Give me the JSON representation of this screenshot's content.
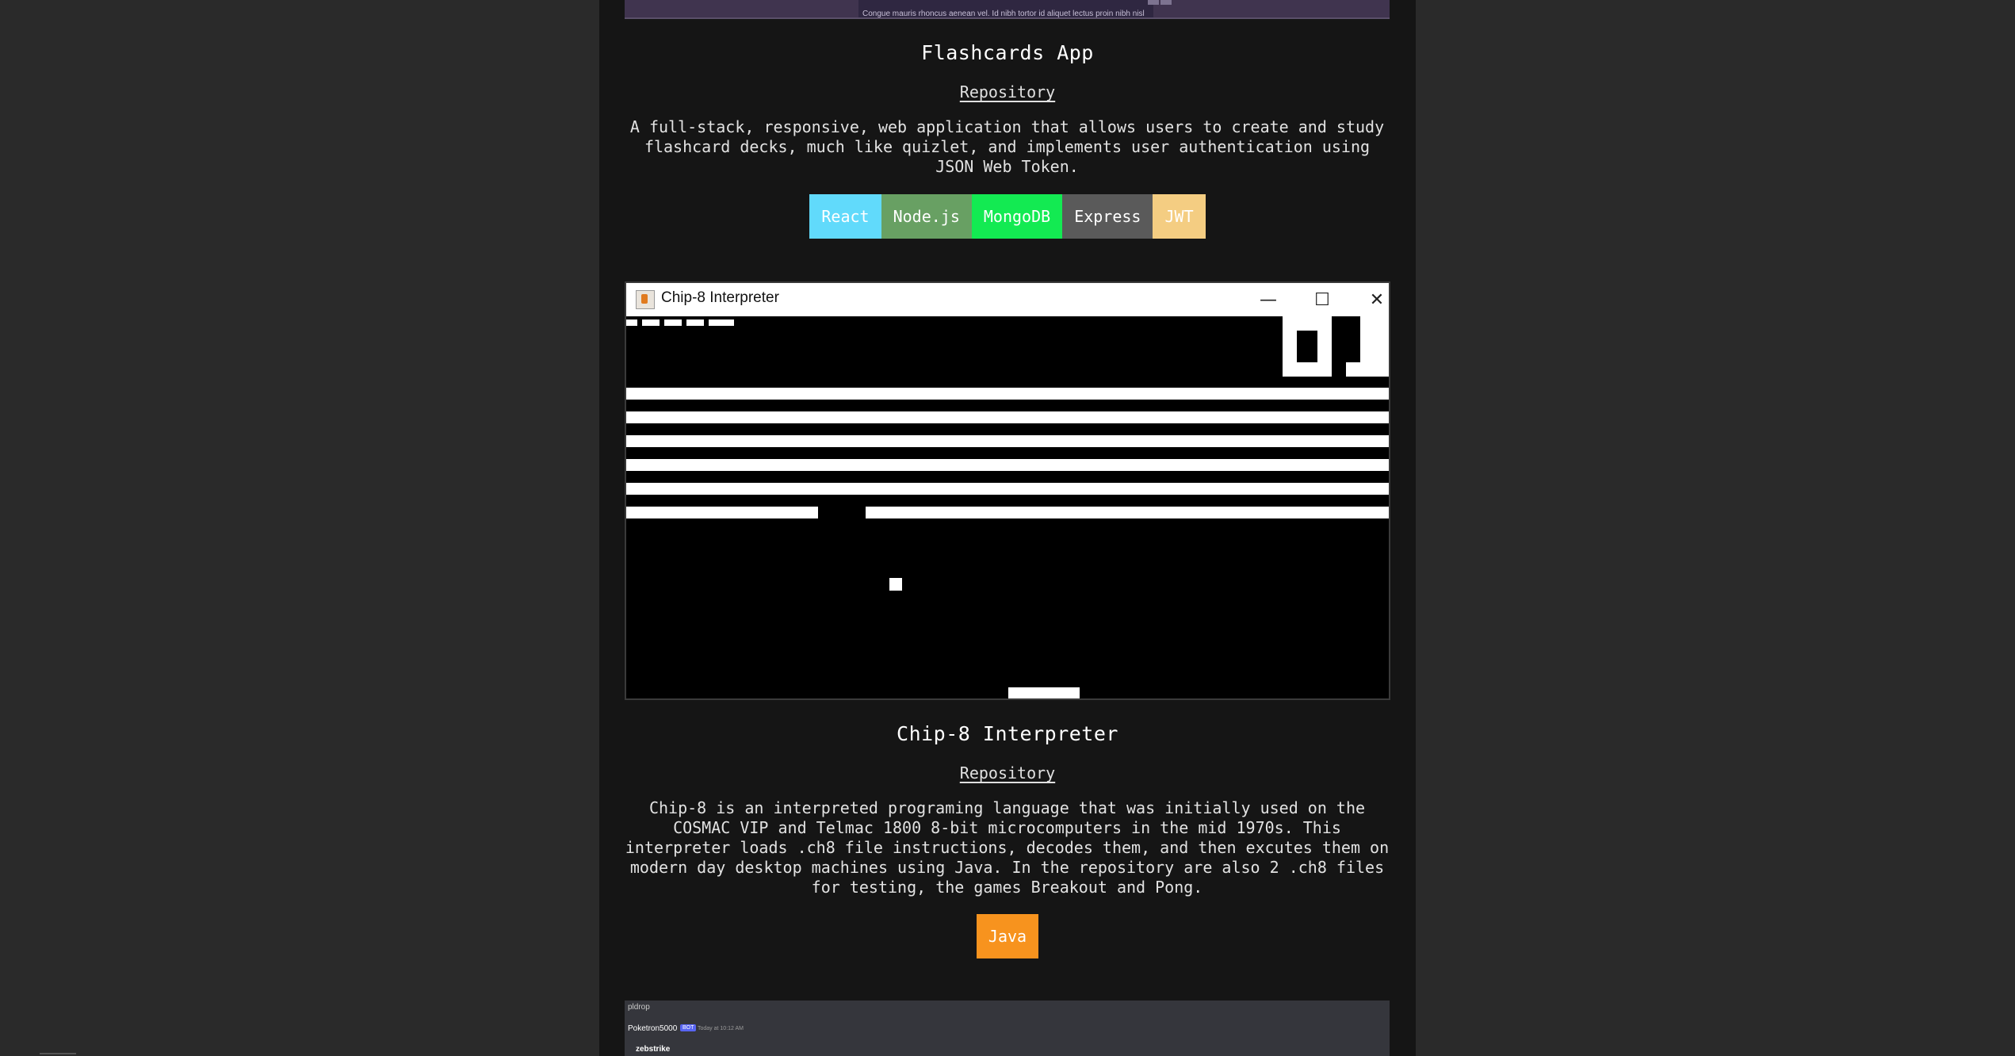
{
  "top_screenshot": {
    "caption": "Congue mauris rhoncus aenean vel. Id nibh tortor id aliquet lectus proin nibh nisl"
  },
  "projects": [
    {
      "title": "Flashcards App",
      "repo_label": "Repository",
      "description": "A full-stack, responsive, web application that allows users to create and study flashcard decks, much like quizlet, and implements user authentication using JSON Web Token.",
      "tags": [
        {
          "label": "React",
          "bg": "#61dafb",
          "fg": "#ffffff"
        },
        {
          "label": "Node.js",
          "bg": "#68a063",
          "fg": "#ffffff"
        },
        {
          "label": "MongoDB",
          "bg": "#13ea52",
          "fg": "#ffffff"
        },
        {
          "label": "Express",
          "bg": "#5a5a5a",
          "fg": "#ffffff"
        },
        {
          "label": "JWT",
          "bg": "#f4cd82",
          "fg": "#ffffff"
        }
      ]
    },
    {
      "title": "Chip-8 Interpreter",
      "repo_label": "Repository",
      "description": "Chip-8 is an interpreted programing language that was initially used on the COSMAC VIP and Telmac 1800 8-bit microcomputers in the mid 1970s. This interpreter loads .ch8 file instructions, decodes them, and then excutes them on modern day desktop machines using Java. In the repository are also 2 .ch8 files for testing, the games Breakout and Pong.",
      "tags": [
        {
          "label": "Java",
          "bg": "#f7931e",
          "fg": "#ffffff"
        }
      ]
    }
  ],
  "chip8_window": {
    "title": "Chip-8 Interpreter",
    "minimize_glyph": "—",
    "maximize_glyph": "☐",
    "close_glyph": "✕",
    "icon": "java-app-icon"
  },
  "bottom_screenshot": {
    "channel": "pldrop",
    "user": "Poketron5000",
    "bot_badge": "BOT",
    "time": "Today at 10:12 AM",
    "message": "zebstrike"
  }
}
